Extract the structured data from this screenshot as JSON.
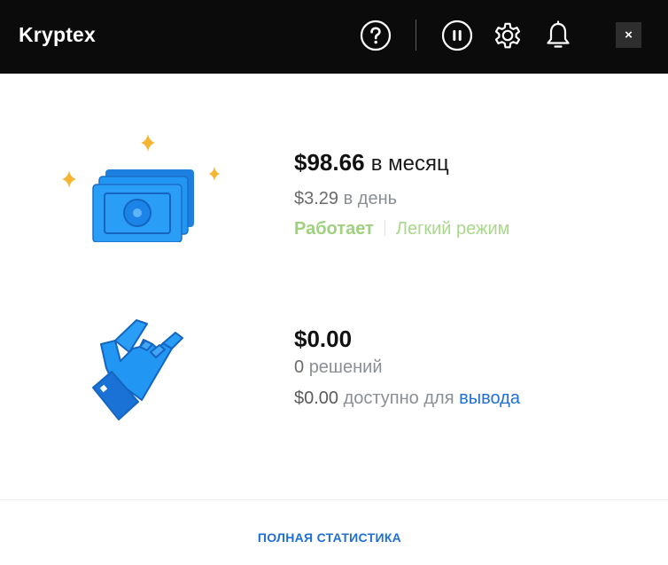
{
  "app": {
    "title": "Kryptex"
  },
  "header": {
    "help_icon": "question-circle-icon",
    "pause_icon": "pause-circle-icon",
    "settings_icon": "gear-icon",
    "notifications_icon": "bell-icon",
    "close_label": "×"
  },
  "earnings": {
    "monthly_amount": "$98.66",
    "monthly_unit": "в месяц",
    "daily_amount": "$3.29",
    "daily_unit": "в день",
    "status": "Работает",
    "mode": "Легкий режим"
  },
  "balance": {
    "amount": "$0.00",
    "solutions_count": "0",
    "solutions_label": "решений",
    "available_amount": "$0.00",
    "available_label": "доступно для",
    "withdraw_link": "вывода"
  },
  "footer": {
    "stats_link": "ПОЛНАЯ СТАТИСТИКА"
  },
  "colors": {
    "header_bg": "#0b0b0b",
    "accent_blue": "#1f6fd6",
    "illustration_blue": "#2196f3",
    "sparkle": "#f5b431",
    "status_green": "#9fd17f"
  }
}
